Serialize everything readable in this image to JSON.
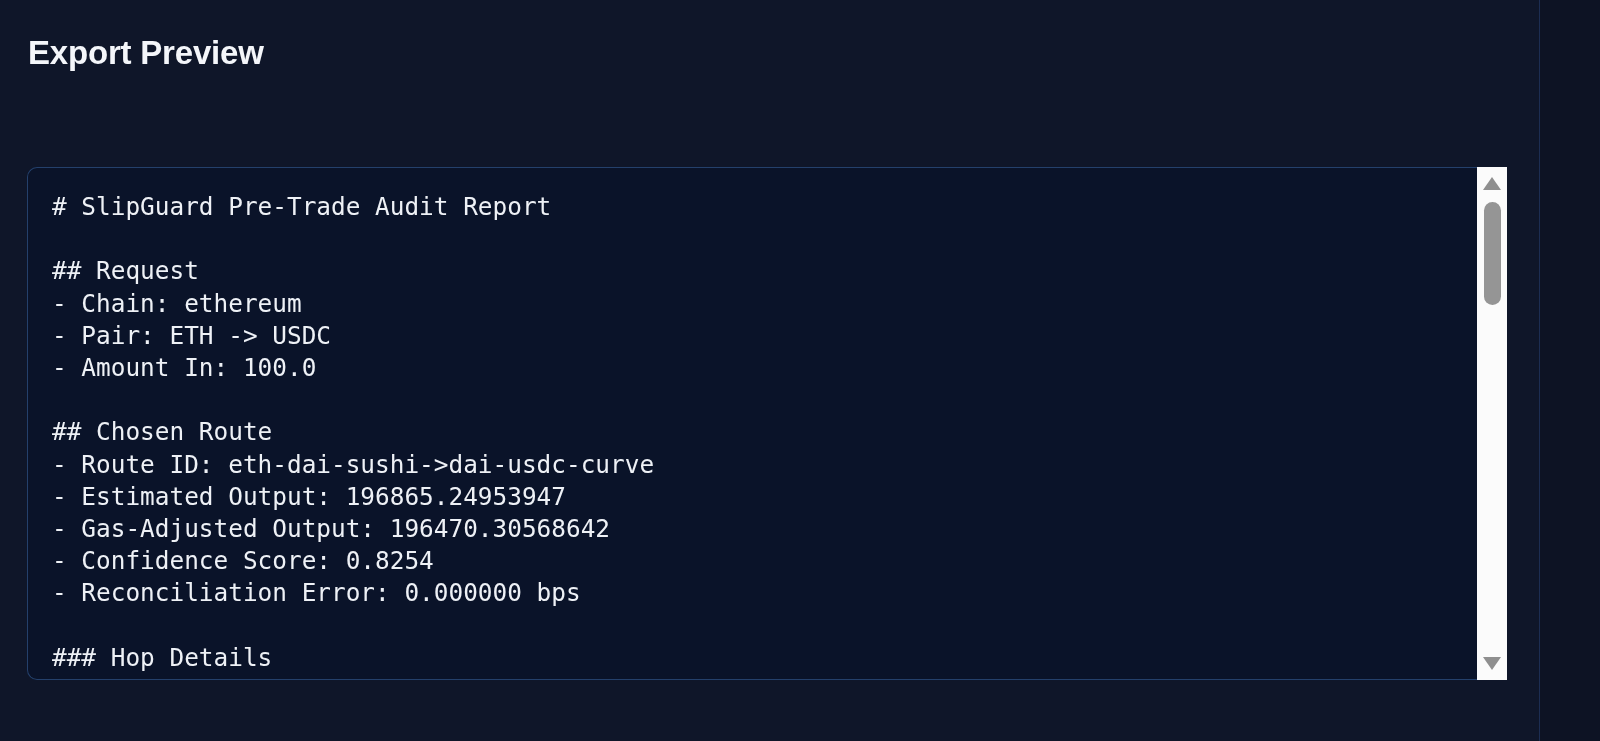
{
  "page_title": "Export Preview",
  "report": {
    "title": "# SlipGuard Pre-Trade Audit Report",
    "sections": [
      {
        "heading": "## Request",
        "items": [
          "- Chain: ethereum",
          "- Pair: ETH -> USDC",
          "- Amount In: 100.0"
        ]
      },
      {
        "heading": "## Chosen Route",
        "items": [
          "- Route ID: eth-dai-sushi->dai-usdc-curve",
          "- Estimated Output: 196865.24953947",
          "- Gas-Adjusted Output: 196470.30568642",
          "- Confidence Score: 0.8254",
          "- Reconciliation Error: 0.000000 bps"
        ]
      },
      {
        "heading": "### Hop Details"
      }
    ]
  }
}
